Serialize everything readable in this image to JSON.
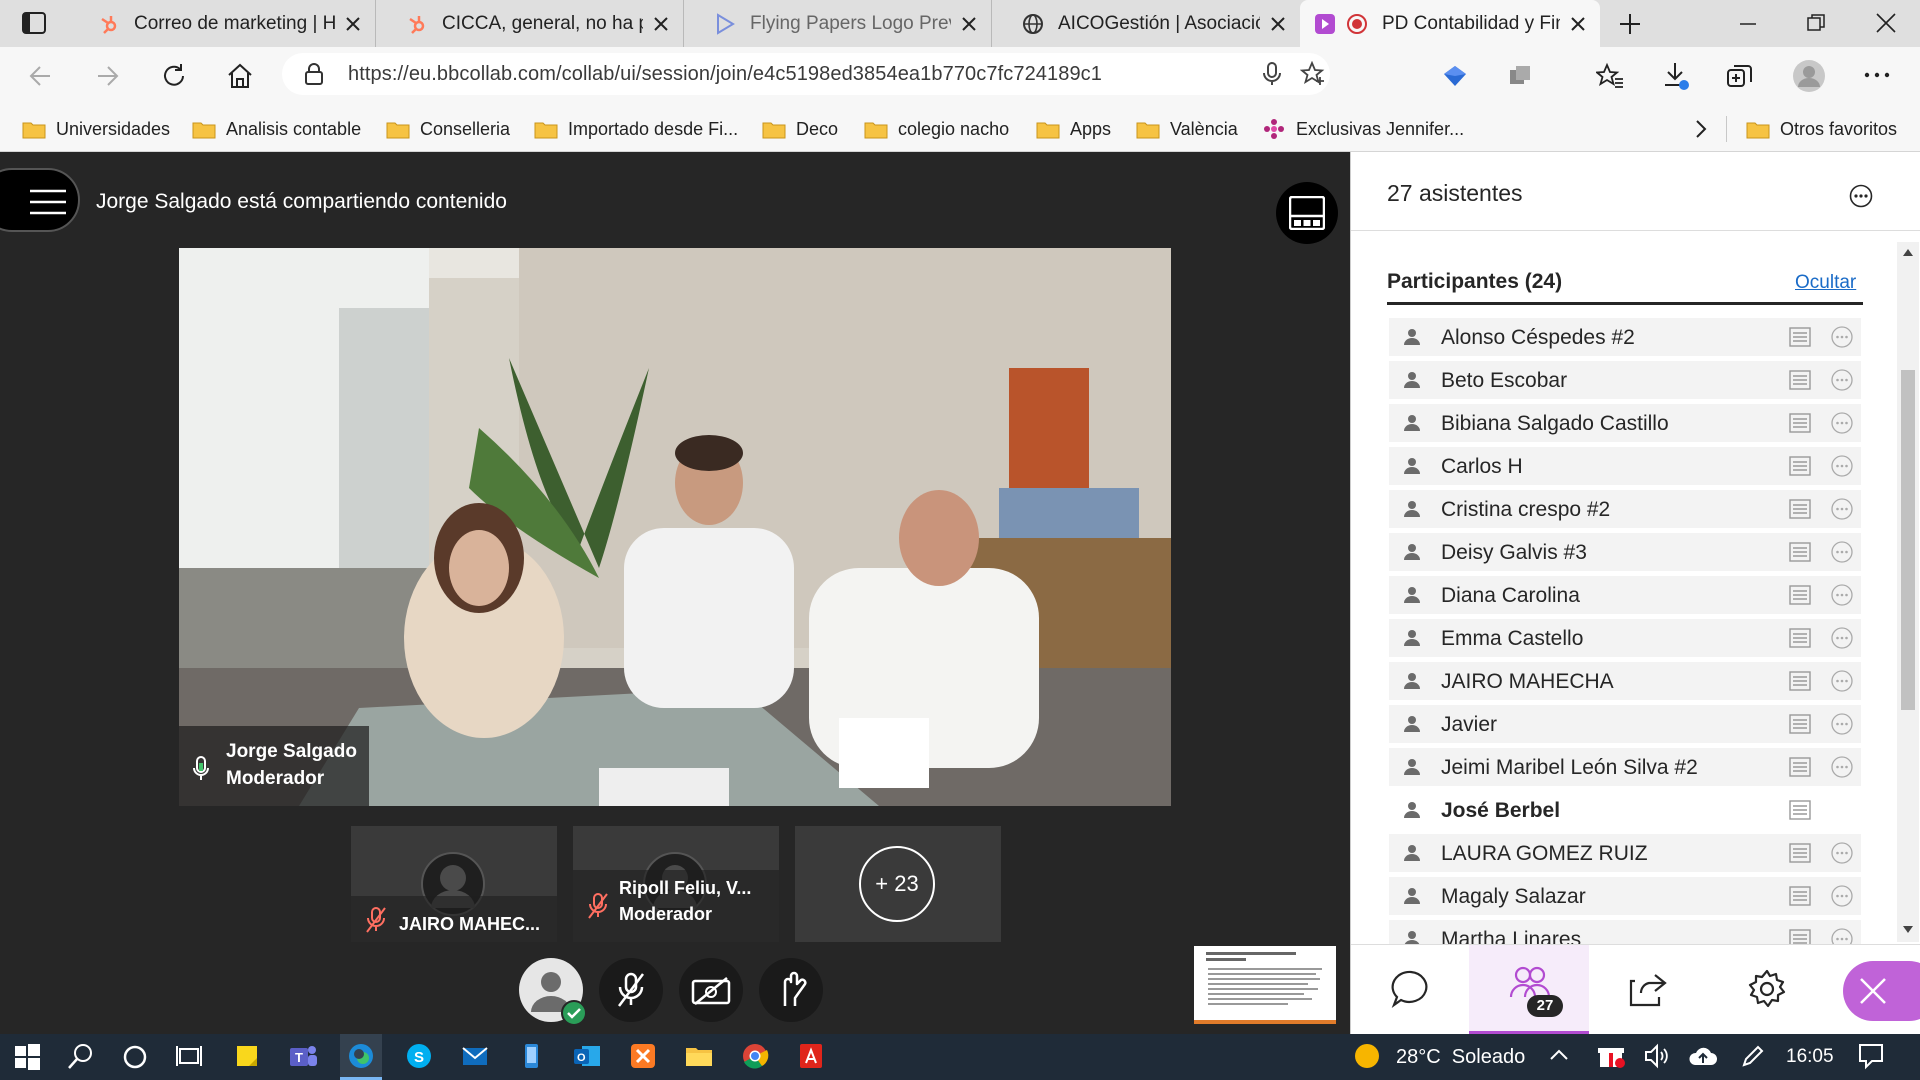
{
  "browser": {
    "tabs": [
      {
        "title": "Correo de marketing | HubSpot",
        "icon": "hubspot-icon"
      },
      {
        "title": "CICCA, general, no ha proporcionado",
        "icon": "hubspot-icon"
      },
      {
        "title": "Flying Papers Logo Preview",
        "icon": "play-triangle-icon"
      },
      {
        "title": "AICOGestión | Asociación",
        "icon": "globe-icon"
      },
      {
        "title": "PD Contabilidad y Finanzas",
        "icon": "record-icon",
        "active": true
      }
    ],
    "url": "https://eu.bbcollab.com/collab/ui/session/join/e4c5198ed3854ea1b770c7fc724189c1",
    "bookmarks": [
      "Universidades",
      "Analisis contable",
      "Conselleria",
      "Importado desde Fi...",
      "Deco",
      "colegio nacho",
      "Apps",
      "València",
      "Exclusivas Jennifer..."
    ],
    "other_favorites": "Otros favoritos"
  },
  "session": {
    "sharing_text": "Jorge Salgado está compartiendo contenido",
    "main_video": {
      "name": "Jorge Salgado",
      "role": "Moderador"
    },
    "tiles": [
      {
        "name": "JAIRO MAHEC...",
        "role": ""
      },
      {
        "name": "Ripoll Feliu, V...",
        "role": "Moderador"
      }
    ],
    "more_count": "+ 23"
  },
  "panel": {
    "attendees_title": "27 asistentes",
    "section_title": "Participantes (24)",
    "hide_label": "Ocultar",
    "participants": [
      {
        "name": "Alonso Céspedes #2",
        "bold": false
      },
      {
        "name": "Beto Escobar",
        "bold": false
      },
      {
        "name": "Bibiana Salgado Castillo",
        "bold": false
      },
      {
        "name": "Carlos H",
        "bold": false
      },
      {
        "name": "Cristina crespo #2",
        "bold": false
      },
      {
        "name": "Deisy Galvis #3",
        "bold": false
      },
      {
        "name": "Diana Carolina",
        "bold": false
      },
      {
        "name": "Emma Castello",
        "bold": false
      },
      {
        "name": "JAIRO MAHECHA",
        "bold": false
      },
      {
        "name": "Javier",
        "bold": false
      },
      {
        "name": "Jeimi Maribel León Silva #2",
        "bold": false
      },
      {
        "name": "José Berbel",
        "bold": true
      },
      {
        "name": "LAURA GOMEZ RUIZ",
        "bold": false
      },
      {
        "name": "Magaly Salazar",
        "bold": false
      },
      {
        "name": "Martha Linares",
        "bold": false
      }
    ],
    "attendee_badge": "27"
  },
  "taskbar": {
    "weather": "28°C  Soleado",
    "time": "16:05"
  },
  "colors": {
    "stage_bg": "#262626",
    "accent_purple": "#b24bd1",
    "link_blue": "#1a6bc7",
    "taskbar_bg": "#1f2b38"
  }
}
